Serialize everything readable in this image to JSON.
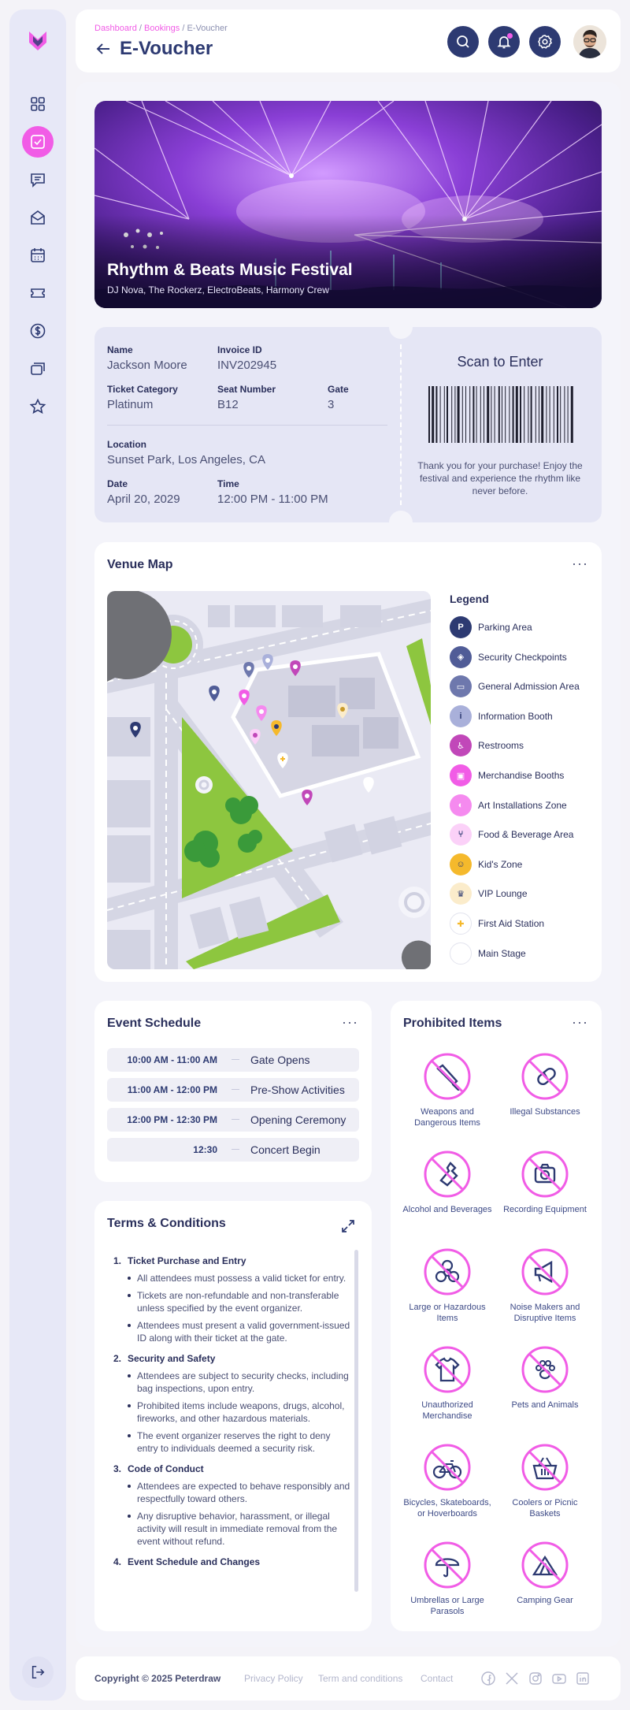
{
  "breadcrumb": {
    "home": "Dashboard",
    "sep": "/",
    "section": "Bookings",
    "current": "E-Voucher"
  },
  "page": {
    "title": "E-Voucher"
  },
  "event": {
    "title": "Rhythm & Beats Music Festival",
    "lineup": "DJ Nova, The Rockerz, ElectroBeats, Harmony Crew"
  },
  "ticket": {
    "name_label": "Name",
    "name": "Jackson Moore",
    "invoice_label": "Invoice ID",
    "invoice": "INV202945",
    "category_label": "Ticket Category",
    "category": "Platinum",
    "seat_label": "Seat Number",
    "seat": "B12",
    "gate_label": "Gate",
    "gate": "3",
    "location_label": "Location",
    "location": "Sunset Park, Los Angeles, CA",
    "date_label": "Date",
    "date": "April 20, 2029",
    "time_label": "Time",
    "time": "12:00 PM - 11:00 PM",
    "scan_title": "Scan to Enter",
    "thanks": "Thank you for your purchase! Enjoy the festival and experience the rhythm like never before."
  },
  "venue_map": {
    "title": "Venue Map",
    "legend_title": "Legend",
    "legend": [
      {
        "label": "Parking Area",
        "color": "#2d3a72",
        "icon": "parking-icon"
      },
      {
        "label": "Security Checkpoints",
        "color": "#505c97",
        "icon": "shield-icon"
      },
      {
        "label": "General Admission Area",
        "color": "#6e78ad",
        "icon": "ticket-icon"
      },
      {
        "label": "Information Booth",
        "color": "#a9b0da",
        "icon": "info-icon"
      },
      {
        "label": "Restrooms",
        "color": "#c147b9",
        "icon": "restroom-icon"
      },
      {
        "label": "Merchandise Booths",
        "color": "#f15ce6",
        "icon": "shop-icon"
      },
      {
        "label": "Art Installations Zone",
        "color": "#f58aef",
        "icon": "palette-icon"
      },
      {
        "label": "Food & Beverage Area",
        "color": "#fbd1f8",
        "icon": "food-icon"
      },
      {
        "label": "Kid's Zone",
        "color": "#f5b92c",
        "icon": "kids-icon"
      },
      {
        "label": "VIP Lounge",
        "color": "#fbeccb",
        "icon": "vip-icon"
      },
      {
        "label": "First Aid Station",
        "color": "#ffffff",
        "icon": "first-aid-icon"
      },
      {
        "label": "Main Stage",
        "color": "#ffffff",
        "icon": "stage-icon"
      }
    ]
  },
  "schedule": {
    "title": "Event Schedule",
    "items": [
      {
        "time": "10:00 AM - 11:00 AM",
        "event": "Gate Opens"
      },
      {
        "time": "11:00 AM - 12:00 PM",
        "event": "Pre-Show Activities"
      },
      {
        "time": "12:00 PM - 12:30 PM",
        "event": "Opening Ceremony"
      },
      {
        "time": "12:30",
        "event": "Concert Begin"
      }
    ]
  },
  "terms": {
    "title": "Terms & Conditions",
    "sections": [
      {
        "num": "1.",
        "title": "Ticket Purchase and Entry",
        "items": [
          "All attendees must possess a valid ticket for entry.",
          "Tickets are non-refundable and non-transferable unless specified by the event organizer.",
          "Attendees must present a valid government-issued ID along with their ticket at the gate."
        ]
      },
      {
        "num": "2.",
        "title": "Security and Safety",
        "items": [
          "Attendees are subject to security checks, including bag inspections, upon entry.",
          "Prohibited items include weapons, drugs, alcohol, fireworks, and other hazardous materials.",
          "The event organizer reserves the right to deny entry to individuals deemed a security risk."
        ]
      },
      {
        "num": "3.",
        "title": "Code of Conduct",
        "items": [
          "Attendees are expected to behave responsibly and respectfully toward others.",
          "Any disruptive behavior, harassment, or illegal activity will result in immediate removal from the event without refund."
        ]
      },
      {
        "num": "4.",
        "title": "Event Schedule and Changes",
        "items": []
      }
    ]
  },
  "prohibited": {
    "title": "Prohibited Items",
    "items": [
      {
        "label": "Weapons and Dangerous Items",
        "icon": "knife-icon"
      },
      {
        "label": "Illegal Substances",
        "icon": "pill-icon"
      },
      {
        "label": "Alcohol and Beverages",
        "icon": "bottle-icon"
      },
      {
        "label": "Recording Equipment",
        "icon": "camera-icon"
      },
      {
        "label": "Large or Hazardous Items",
        "icon": "biohazard-icon"
      },
      {
        "label": "Noise Makers and Disruptive Items",
        "icon": "megaphone-icon"
      },
      {
        "label": "Unauthorized Merchandise",
        "icon": "tshirt-icon"
      },
      {
        "label": "Pets and Animals",
        "icon": "paw-icon"
      },
      {
        "label": "Bicycles, Skateboards, or Hoverboards",
        "icon": "bicycle-icon"
      },
      {
        "label": "Coolers or Picnic Baskets",
        "icon": "basket-icon"
      },
      {
        "label": "Umbrellas or Large Parasols",
        "icon": "umbrella-icon"
      },
      {
        "label": "Camping Gear",
        "icon": "tent-icon"
      }
    ]
  },
  "footer": {
    "copyright": "Copyright © 2025 Peterdraw",
    "links": [
      "Privacy Policy",
      "Term and conditions",
      "Contact"
    ]
  },
  "colors": {
    "navy": "#2d3a72",
    "pink": "#f15ce6",
    "green": "#8dc63f"
  }
}
